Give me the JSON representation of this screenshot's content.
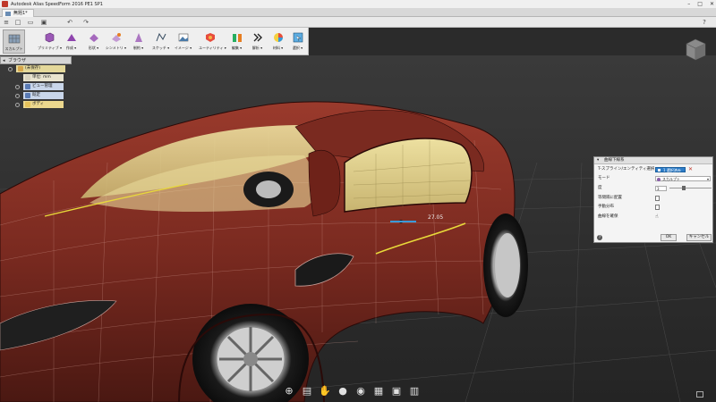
{
  "app": {
    "title": "Autodesk Alias SpeedForm 2016 PE1 SP1",
    "window_controls": [
      "–",
      "□",
      "✕"
    ]
  },
  "document_tab": {
    "label": "無題1*"
  },
  "ribbon": {
    "tools": [
      {
        "id": "sculpt",
        "label": "スカルプト",
        "icon": "sculpt-icon",
        "active": true
      },
      {
        "id": "primitive",
        "label": "プリミティブ ▾",
        "icon": "cube-icon"
      },
      {
        "id": "create",
        "label": "作成 ▾",
        "icon": "create-icon"
      },
      {
        "id": "modify",
        "label": "形状 ▾",
        "icon": "modify-icon"
      },
      {
        "id": "symmetry",
        "label": "シンメトリ ▾",
        "icon": "symmetry-icon"
      },
      {
        "id": "surface",
        "label": "制約 ▾",
        "icon": "constraint-icon"
      },
      {
        "id": "sketch",
        "label": "スケッチ ▾",
        "icon": "sketch-icon"
      },
      {
        "id": "image",
        "label": "イメージ ▾",
        "icon": "image-icon"
      },
      {
        "id": "utility",
        "label": "ユーティリティ ▾",
        "icon": "utility-icon"
      },
      {
        "id": "edit",
        "label": "編集 ▾",
        "icon": "edit-icon"
      },
      {
        "id": "analyze",
        "label": "解析 ▾",
        "icon": "analyze-icon"
      },
      {
        "id": "material",
        "label": "材料 ▾",
        "icon": "material-icon"
      },
      {
        "id": "select",
        "label": "選択 ▾",
        "icon": "select-icon"
      }
    ]
  },
  "browser": {
    "header": "ブラウザ",
    "root": "(未保存)",
    "items": [
      {
        "label": "単位: mm",
        "color": "#d9d3c0"
      },
      {
        "label": "ビュー管理",
        "color": "#5a7bb5"
      },
      {
        "label": "既定",
        "color": "#5a7bb5"
      },
      {
        "label": "ボディ",
        "color": "#e6c25a"
      }
    ]
  },
  "dialog": {
    "title": "曲線下線系",
    "rows": {
      "select_label": "T-スプライン/エンティティ選択",
      "select_button": "1 選択済み",
      "mode_label": "モード",
      "mode_value": "スカルプト",
      "degree_label": "度",
      "degree_value": "3",
      "align_label": "等間隔に配置",
      "hand_label": "手動分布",
      "curve_label": "曲線を確保"
    },
    "ok": "OK",
    "cancel": "キャンセル",
    "help": "?"
  },
  "viewport": {
    "annotation_label": "27.05"
  },
  "navbar": {
    "items": [
      "orbit-icon",
      "look-icon",
      "pan-icon",
      "zoom-icon",
      "zoom-window-icon",
      "display-icon",
      "viewports-icon",
      "grid-icon"
    ]
  },
  "colors": {
    "body_paint": "#7d2b22",
    "interior": "#e0cf8a",
    "curve_highlight": "#e8d93a",
    "accent_blue": "#2e7dc8"
  }
}
